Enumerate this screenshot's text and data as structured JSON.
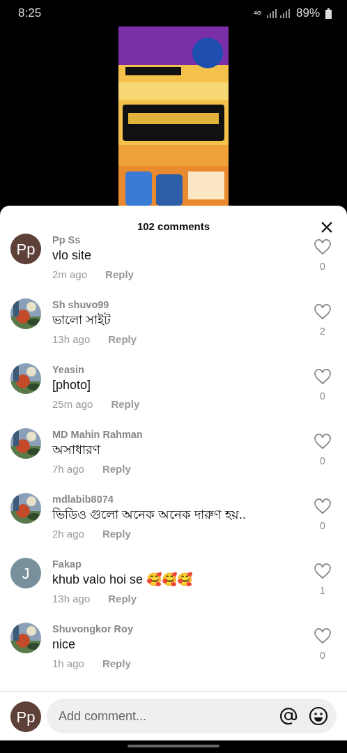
{
  "status_bar": {
    "time": "8:25",
    "network": "4G",
    "battery": "89%"
  },
  "comments_sheet": {
    "title": "102 comments",
    "comments": [
      {
        "avatar": {
          "kind": "letter",
          "text": "Pp",
          "color": "#5d4037"
        },
        "user": "Pp Ss",
        "text": "vlo site",
        "time": "2m ago",
        "reply": "Reply",
        "likes": "0",
        "liked": false
      },
      {
        "user": "Sh shuvo99",
        "text": "ভালো সাইট",
        "time": "13h ago",
        "reply": "Reply",
        "likes": "2",
        "liked": false
      },
      {
        "user": "Yeasin",
        "text": " [photo]",
        "time": "25m ago",
        "reply": "Reply",
        "likes": "0",
        "liked": false
      },
      {
        "user": "MD Mahin Rahman",
        "text": "অসাধারণ",
        "time": "7h ago",
        "reply": "Reply",
        "likes": "0",
        "liked": false
      },
      {
        "user": "mdlabib8074",
        "text": "ভিডিও গুলো অনেক অনেক দারুণ হয়..",
        "time": "2h ago",
        "reply": "Reply",
        "likes": "0",
        "liked": false
      },
      {
        "avatar": {
          "kind": "letter",
          "text": "J",
          "color": "#78909c"
        },
        "user": "Fakap",
        "text": "khub valo hoi se 🥰🥰🥰",
        "time": "13h ago",
        "reply": "Reply",
        "likes": "1",
        "liked": false
      },
      {
        "user": "Shuvongkor Roy",
        "text": "nice",
        "time": "1h ago",
        "reply": "Reply",
        "likes": "0",
        "liked": false
      }
    ],
    "composer": {
      "avatar_text": "Pp",
      "placeholder": "Add comment..."
    }
  }
}
